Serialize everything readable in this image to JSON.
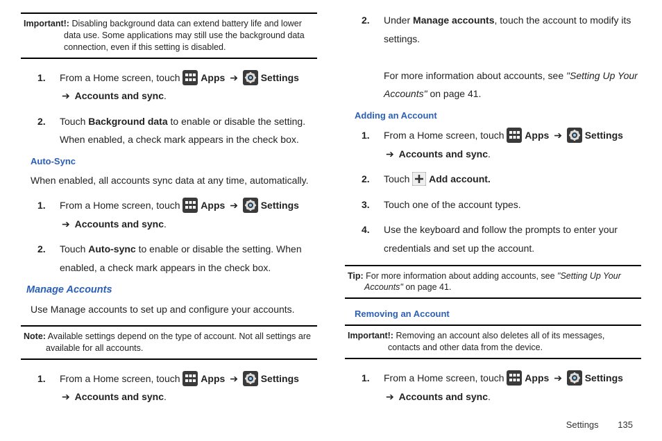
{
  "left": {
    "important": {
      "label": "Important!:",
      "text": "Disabling background data can extend battery life and lower data use. Some applications may still use the background data connection, even if this setting is disabled."
    },
    "bg_steps": [
      {
        "n": "1.",
        "pre": "From a Home screen, touch ",
        "apps": "Apps",
        "settings": "Settings",
        "tail": "Accounts and sync",
        "dot": "."
      },
      {
        "n": "2.",
        "t1": "Touch ",
        "b1": "Background data",
        "t2": " to enable or disable the setting. When enabled, a check mark appears in the check box."
      }
    ],
    "autosync_h": "Auto-Sync",
    "autosync_p": "When enabled, all accounts sync data at any time, automatically.",
    "autosync_steps": [
      {
        "n": "1.",
        "pre": "From a Home screen, touch ",
        "apps": "Apps",
        "settings": "Settings",
        "tail": "Accounts and sync",
        "dot": "."
      },
      {
        "n": "2.",
        "t1": "Touch ",
        "b1": "Auto-sync",
        "t2": " to enable or disable the setting. When enabled, a check mark appears in the check box."
      }
    ],
    "manage_h": "Manage Accounts",
    "manage_p": "Use Manage accounts to set up and configure your accounts.",
    "note": {
      "label": "Note:",
      "text": "Available settings depend on the type of account. Not all settings are available for all accounts."
    },
    "manage_steps": [
      {
        "n": "1.",
        "pre": "From a Home screen, touch ",
        "apps": "Apps",
        "settings": "Settings",
        "tail": "Accounts and sync",
        "dot": "."
      }
    ]
  },
  "right": {
    "top_steps": [
      {
        "n": "2.",
        "t1": "Under ",
        "b1": "Manage accounts",
        "t2": ", touch the account to modify its settings.",
        "extra_pre": "For more information about accounts, see ",
        "extra_it": "\"Setting Up Your Accounts\"",
        "extra_post": " on page 41."
      }
    ],
    "adding_h": "Adding an Account",
    "adding_steps": [
      {
        "n": "1.",
        "pre": "From a Home screen, touch ",
        "apps": "Apps",
        "settings": "Settings",
        "tail": "Accounts and sync",
        "dot": "."
      },
      {
        "n": "2.",
        "t1": "Touch ",
        "b1": " Add account."
      },
      {
        "n": "3.",
        "plain": "Touch one of the account types."
      },
      {
        "n": "4.",
        "plain": "Use the keyboard and follow the prompts to enter your credentials and set up the account."
      }
    ],
    "tip": {
      "label": "Tip:",
      "pre": "For more information about adding accounts, see ",
      "it": "\"Setting Up Your Accounts\"",
      "post": " on page 41."
    },
    "removing_h": "Removing an Account",
    "important": {
      "label": "Important!:",
      "text": "Removing an account also deletes all of its messages, contacts and other data from the device."
    },
    "removing_steps": [
      {
        "n": "1.",
        "pre": "From a Home screen, touch ",
        "apps": "Apps",
        "settings": "Settings",
        "tail": "Accounts and sync",
        "dot": "."
      }
    ]
  },
  "footer": {
    "section": "Settings",
    "page": "135"
  },
  "glyphs": {
    "arrow": "➔"
  }
}
